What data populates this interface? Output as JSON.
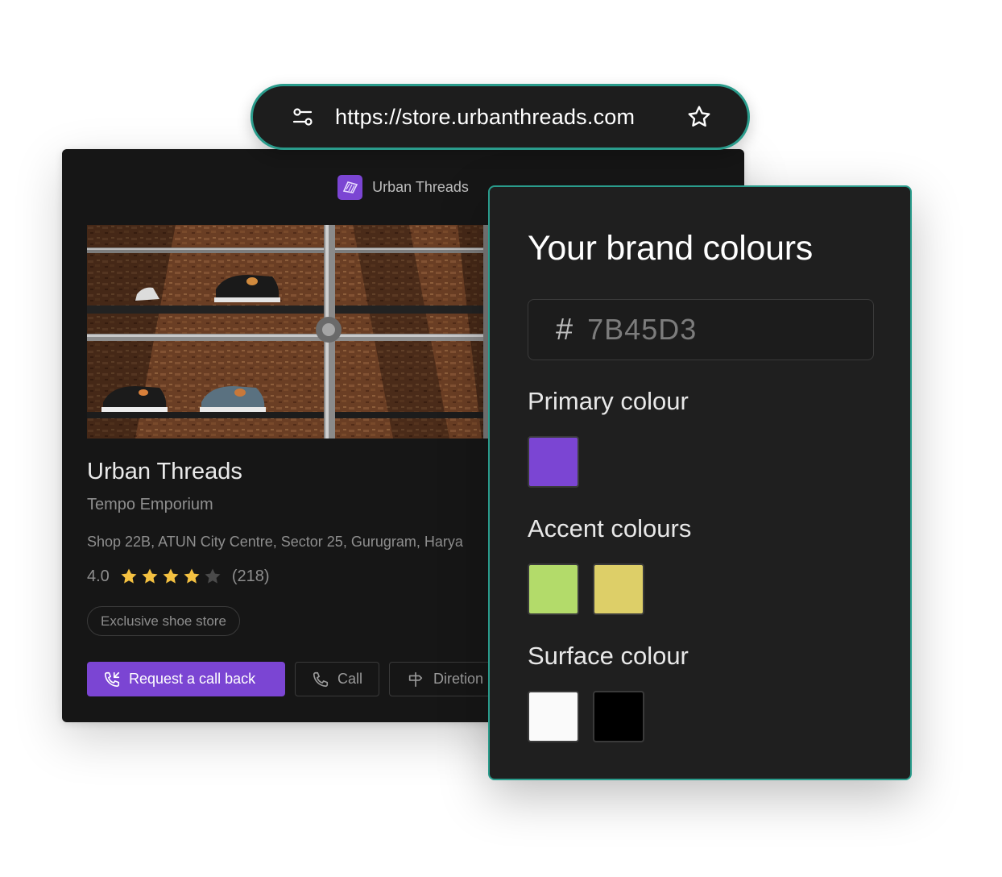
{
  "browser": {
    "url": "https://store.urbanthreads.com"
  },
  "store": {
    "brand_name": "Urban Threads",
    "name": "Urban Threads",
    "category": "Tempo  Emporium",
    "address": "Shop 22B, ATUN City Centre, Sector 25, Gurugram, Harya",
    "rating": "4.0",
    "stars_filled": 4,
    "stars_total": 5,
    "review_count": "(218)",
    "tag": "Exclusive shoe store",
    "actions": {
      "request_callback": "Request a call back",
      "call": "Call",
      "directions": "Diretion"
    }
  },
  "brand_panel": {
    "title": "Your brand colours",
    "hex_symbol": "#",
    "hex_value": "7B45D3",
    "primary_label": "Primary colour",
    "primary_colors": [
      "#7B45D3"
    ],
    "accent_label": "Accent colours",
    "accent_colors": [
      "#B3DB6A",
      "#DDCF68"
    ],
    "surface_label": "Surface colour",
    "surface_colors": [
      "#FAFAFA",
      "#000000"
    ]
  },
  "colors": {
    "brand_purple": "#7B45D3",
    "teal_border": "#2A9C8C",
    "star_yellow": "#F4C141",
    "star_empty": "#4A4A4A"
  }
}
